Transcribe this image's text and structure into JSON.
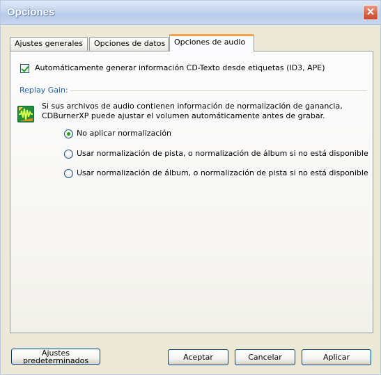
{
  "window": {
    "title": "Opciones",
    "close_symbol": "✕"
  },
  "tabs": [
    {
      "label": "Ajustes generales",
      "active": false
    },
    {
      "label": "Opciones de datos",
      "active": false
    },
    {
      "label": "Opciones de audio",
      "active": true
    }
  ],
  "audio": {
    "cdtext_checkbox": {
      "label": "Automáticamente generar información CD-Texto desde etiquetas (ID3, APE)",
      "checked": true
    },
    "replay_gain": {
      "group_label": "Replay Gain:",
      "description_line1": "Si sus archivos de audio contienen información de normalización de ganancia,",
      "description_line2": "CDBurnerXP puede ajustar el volumen automáticamente antes de grabar.",
      "options": [
        {
          "label": "No aplicar normalización",
          "selected": true
        },
        {
          "label": "Usar normalización de pista, o normalización de álbum si no está disponible",
          "selected": false
        },
        {
          "label": "Usar normalización de álbum, o normalización de pista si no está disponible",
          "selected": false
        }
      ]
    }
  },
  "buttons": {
    "defaults_line1": "Ajustes",
    "defaults_line2": "predeterminados",
    "ok": "Aceptar",
    "cancel": "Cancelar",
    "apply": "Aplicar"
  },
  "colors": {
    "titlebar": "#c8d7ef",
    "close": "#d9684e",
    "active_tab_accent": "#f3a14b",
    "replay_gain_label": "#1f5fb3",
    "check_green": "#21a121"
  }
}
